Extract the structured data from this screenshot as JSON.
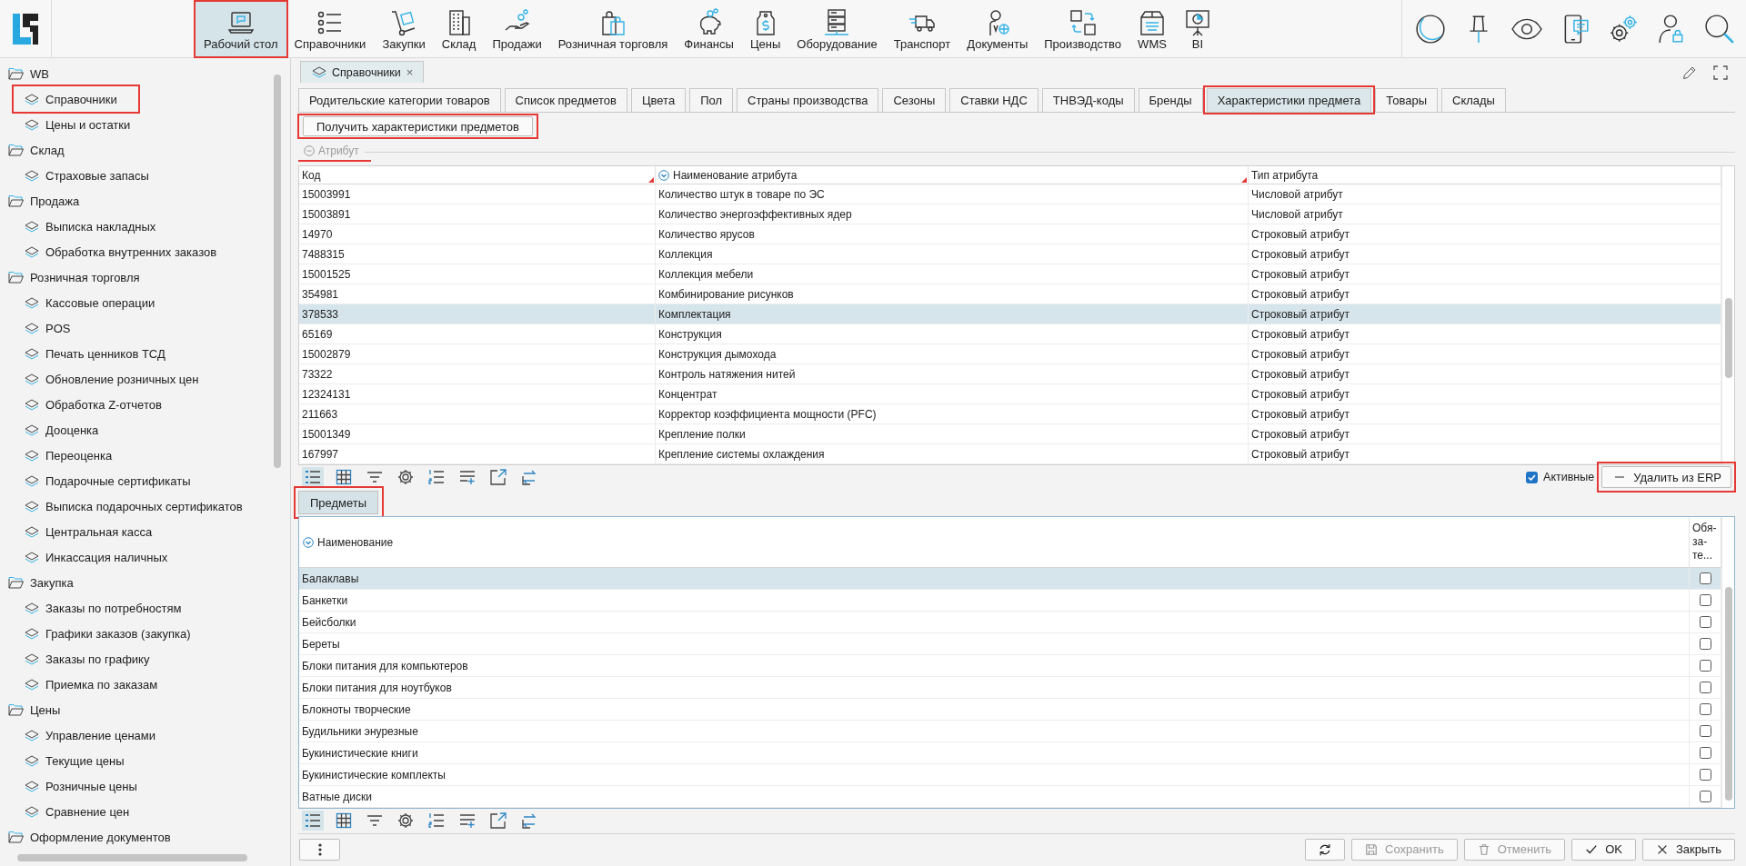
{
  "toolbar": {
    "items": [
      {
        "label": "Рабочий стол",
        "selected": true,
        "highlighted": true
      },
      {
        "label": "Справочники",
        "selected": false,
        "highlighted": false
      },
      {
        "label": "Закупки",
        "selected": false,
        "highlighted": false
      },
      {
        "label": "Склад",
        "selected": false,
        "highlighted": false
      },
      {
        "label": "Продажи",
        "selected": false,
        "highlighted": false
      },
      {
        "label": "Розничная торговля",
        "selected": false,
        "highlighted": false
      },
      {
        "label": "Финансы",
        "selected": false,
        "highlighted": false
      },
      {
        "label": "Цены",
        "selected": false,
        "highlighted": false
      },
      {
        "label": "Оборудование",
        "selected": false,
        "highlighted": false
      },
      {
        "label": "Транспорт",
        "selected": false,
        "highlighted": false
      },
      {
        "label": "Документы",
        "selected": false,
        "highlighted": false
      },
      {
        "label": "Производство",
        "selected": false,
        "highlighted": false
      },
      {
        "label": "WMS",
        "selected": false,
        "highlighted": false
      },
      {
        "label": "BI",
        "selected": false,
        "highlighted": false
      }
    ]
  },
  "sidebar": {
    "items": [
      {
        "label": "WB",
        "expanded": true,
        "highlighted": false,
        "children": [
          {
            "label": "Справочники",
            "highlighted": true
          },
          {
            "label": "Цены и остатки",
            "highlighted": false
          }
        ]
      },
      {
        "label": "Склад",
        "expanded": true,
        "highlighted": false,
        "children": [
          {
            "label": "Страховые запасы",
            "highlighted": false
          }
        ]
      },
      {
        "label": "Продажа",
        "expanded": true,
        "highlighted": false,
        "children": [
          {
            "label": "Выписка накладных",
            "highlighted": false
          },
          {
            "label": "Обработка внутренних заказов",
            "highlighted": false
          }
        ]
      },
      {
        "label": "Розничная торговля",
        "expanded": true,
        "highlighted": false,
        "children": [
          {
            "label": "Кассовые операции",
            "highlighted": false
          },
          {
            "label": "POS",
            "highlighted": false
          },
          {
            "label": "Печать ценников ТСД",
            "highlighted": false
          },
          {
            "label": "Обновление розничных цен",
            "highlighted": false
          },
          {
            "label": "Обработка Z-отчетов",
            "highlighted": false
          },
          {
            "label": "Дооценка",
            "highlighted": false
          },
          {
            "label": "Переоценка",
            "highlighted": false
          },
          {
            "label": "Подарочные сертификаты",
            "highlighted": false
          },
          {
            "label": "Выписка подарочных сертификатов",
            "highlighted": false
          },
          {
            "label": "Центральная касса",
            "highlighted": false
          },
          {
            "label": "Инкассация наличных",
            "highlighted": false
          }
        ]
      },
      {
        "label": "Закупка",
        "expanded": true,
        "highlighted": false,
        "children": [
          {
            "label": "Заказы по потребностям",
            "highlighted": false
          },
          {
            "label": "Графики заказов (закупка)",
            "highlighted": false
          },
          {
            "label": "Заказы по графику",
            "highlighted": false
          },
          {
            "label": "Приемка по заказам",
            "highlighted": false
          }
        ]
      },
      {
        "label": "Цены",
        "expanded": true,
        "highlighted": false,
        "children": [
          {
            "label": "Управление ценами",
            "highlighted": false
          },
          {
            "label": "Текущие цены",
            "highlighted": false
          },
          {
            "label": "Розничные цены",
            "highlighted": false
          },
          {
            "label": "Сравнение цен",
            "highlighted": false
          }
        ]
      },
      {
        "label": "Оформление документов",
        "expanded": true,
        "highlighted": false
      }
    ]
  },
  "document_tabs": [
    {
      "label": "Справочники",
      "close": "×",
      "selected": true
    }
  ],
  "tabs": [
    {
      "label": "Родительские категории товаров",
      "selected": false,
      "highlighted": false
    },
    {
      "label": "Список предметов",
      "selected": false,
      "highlighted": false
    },
    {
      "label": "Цвета",
      "selected": false,
      "highlighted": false
    },
    {
      "label": "Пол",
      "selected": false,
      "highlighted": false
    },
    {
      "label": "Страны производства",
      "selected": false,
      "highlighted": false
    },
    {
      "label": "Сезоны",
      "selected": false,
      "highlighted": false
    },
    {
      "label": "Ставки НДС",
      "selected": false,
      "highlighted": false
    },
    {
      "label": "ТНВЭД-коды",
      "selected": false,
      "highlighted": false
    },
    {
      "label": "Бренды",
      "selected": false,
      "highlighted": false
    },
    {
      "label": "Характеристики предмета",
      "selected": true,
      "highlighted": true
    },
    {
      "label": "Товары",
      "selected": false,
      "highlighted": false
    },
    {
      "label": "Склады",
      "selected": false,
      "highlighted": false
    }
  ],
  "fetch_button": {
    "label": "Получить характеристики предметов",
    "highlighted": true
  },
  "attribute_group": {
    "title": "Атрибут",
    "expanded": true,
    "highlighted": true
  },
  "attributes_table": {
    "columns": [
      {
        "label": "Код",
        "dropdown": false,
        "marked": true
      },
      {
        "label": "Наименование атрибута",
        "dropdown": true,
        "marked": true
      },
      {
        "label": "Тип атрибута",
        "dropdown": false,
        "marked": false
      }
    ],
    "rows": [
      {
        "cells": [
          "15003991",
          "Количество штук в товаре по ЭС",
          "Числовой атрибут"
        ],
        "selected": false
      },
      {
        "cells": [
          "15003891",
          "Количество энергоэффективных ядер",
          "Числовой атрибут"
        ],
        "selected": false
      },
      {
        "cells": [
          "14970",
          "Количество ярусов",
          "Строковый атрибут"
        ],
        "selected": false
      },
      {
        "cells": [
          "7488315",
          "Коллекция",
          "Строковый атрибут"
        ],
        "selected": false
      },
      {
        "cells": [
          "15001525",
          "Коллекция мебели",
          "Строковый атрибут"
        ],
        "selected": false
      },
      {
        "cells": [
          "354981",
          "Комбинирование рисунков",
          "Строковый атрибут"
        ],
        "selected": false
      },
      {
        "cells": [
          "378533",
          "Комплектация",
          "Строковый атрибут"
        ],
        "selected": true
      },
      {
        "cells": [
          "65169",
          "Конструкция",
          "Строковый атрибут"
        ],
        "selected": false
      },
      {
        "cells": [
          "15002879",
          "Конструкция дымохода",
          "Строковый атрибут"
        ],
        "selected": false
      },
      {
        "cells": [
          "73322",
          "Контроль натяжения нитей",
          "Строковый атрибут"
        ],
        "selected": false
      },
      {
        "cells": [
          "12324131",
          "Концентрат",
          "Строковый атрибут"
        ],
        "selected": false
      },
      {
        "cells": [
          "211663",
          "Корректор коэффициента мощности (PFC)",
          "Строковый атрибут"
        ],
        "selected": false
      },
      {
        "cells": [
          "15001349",
          "Крепление полки",
          "Строковый атрибут"
        ],
        "selected": false
      },
      {
        "cells": [
          "167997",
          "Крепление системы охлаждения",
          "Строковый атрибут"
        ],
        "selected": false
      }
    ]
  },
  "attributes_tools": [
    {
      "selected": true
    },
    {
      "selected": false
    },
    {
      "selected": false
    },
    {
      "selected": false
    },
    {
      "selected": false
    },
    {
      "selected": false
    },
    {
      "selected": false
    },
    {
      "selected": false
    }
  ],
  "active_filter": {
    "label": "Активные",
    "checked": true
  },
  "remove_button": {
    "label": "Удалить из ERP",
    "highlighted": true
  },
  "subtabs": [
    {
      "label": "Предметы",
      "selected": true,
      "highlighted": true
    }
  ],
  "items_table": {
    "columns": [
      {
        "label": "Наименование",
        "dropdown": true
      },
      {
        "label": "Обя-\nза-\nте...",
        "dropdown": false
      }
    ],
    "rows": [
      {
        "name": "Балаклавы",
        "required": false,
        "selected": true
      },
      {
        "name": "Банкетки",
        "required": false,
        "selected": false
      },
      {
        "name": "Бейсболки",
        "required": false,
        "selected": false
      },
      {
        "name": "Береты",
        "required": false,
        "selected": false
      },
      {
        "name": "Блоки питания для компьютеров",
        "required": false,
        "selected": false
      },
      {
        "name": "Блоки питания для ноутбуков",
        "required": false,
        "selected": false
      },
      {
        "name": "Блокноты творческие",
        "required": false,
        "selected": false
      },
      {
        "name": "Будильники энурезные",
        "required": false,
        "selected": false
      },
      {
        "name": "Букинистические книги",
        "required": false,
        "selected": false
      },
      {
        "name": "Букинистические комплекты",
        "required": false,
        "selected": false
      },
      {
        "name": "Ватные диски",
        "required": false,
        "selected": false
      }
    ]
  },
  "items_tools": [
    {
      "selected": true
    },
    {
      "selected": false
    },
    {
      "selected": false
    },
    {
      "selected": false
    },
    {
      "selected": false
    },
    {
      "selected": false
    },
    {
      "selected": false
    },
    {
      "selected": false
    }
  ],
  "footer": {
    "buttons": [
      {
        "kind": "refresh",
        "disabled": false
      },
      {
        "kind": "save",
        "label": "Сохранить",
        "disabled": true
      },
      {
        "kind": "cancel",
        "label": "Отменить",
        "disabled": true
      },
      {
        "kind": "ok",
        "label": "OK",
        "disabled": false
      },
      {
        "kind": "close",
        "label": "Закрыть",
        "disabled": false
      }
    ]
  }
}
